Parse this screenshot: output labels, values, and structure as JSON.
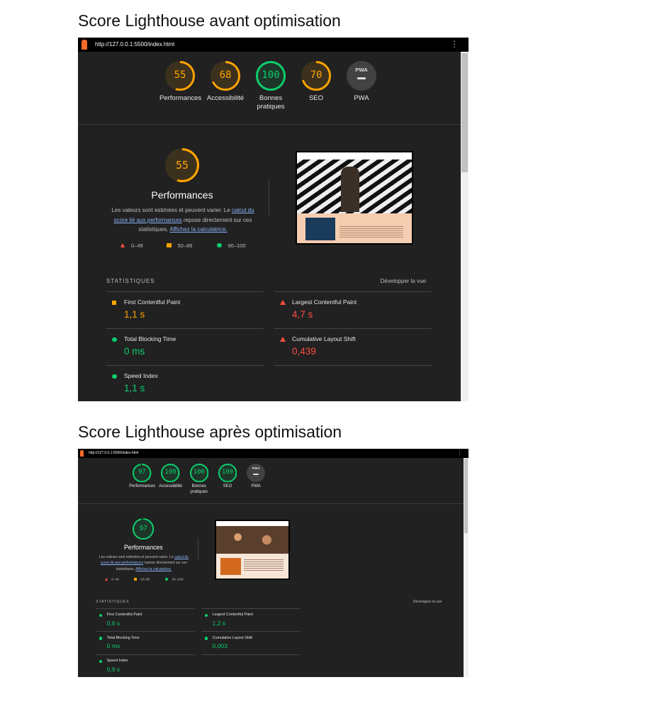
{
  "headings": {
    "before": "Score Lighthouse avant optimisation",
    "after": "Score Lighthouse après optimisation"
  },
  "colors": {
    "fail": "#ff4e42",
    "average": "#ffa400",
    "pass": "#0cce6b",
    "report_bg": "#212121"
  },
  "before": {
    "url": "http://127.0.0.1:5500/index.html",
    "scores": [
      {
        "label": "Performances",
        "value": "55",
        "score": 55,
        "status": "average"
      },
      {
        "label": "Accessibilité",
        "value": "68",
        "score": 68,
        "status": "average"
      },
      {
        "label": "Bonnes pratiques",
        "value": "100",
        "score": 100,
        "status": "pass"
      },
      {
        "label": "SEO",
        "value": "70",
        "score": 70,
        "status": "average"
      },
      {
        "label": "PWA",
        "value": "PWA",
        "status": "na"
      }
    ],
    "perf": {
      "score": 55,
      "value": "55",
      "title": "Performances",
      "desc_1": "Les valeurs sont estimées et peuvent varier. Le ",
      "desc_link_1": "calcul du score lié aux performances",
      "desc_2": " repose directement sur ces statistiques. ",
      "desc_link_2": "Affichez la calculatrice."
    },
    "legend": [
      "0–49",
      "50–89",
      "90–100"
    ],
    "stats_label": "STATISTIQUES",
    "expand_label": "Développer la vue",
    "metrics": [
      {
        "name": "First Contentful Paint",
        "value": "1,1 s",
        "status": "average"
      },
      {
        "name": "Largest Contentful Paint",
        "value": "4,7 s",
        "status": "fail"
      },
      {
        "name": "Total Blocking Time",
        "value": "0 ms",
        "status": "pass"
      },
      {
        "name": "Cumulative Layout Shift",
        "value": "0,439",
        "status": "fail"
      },
      {
        "name": "Speed Index",
        "value": "1,1 s",
        "status": "pass"
      }
    ]
  },
  "after": {
    "url": "http://127.0.0.1:5500/index.html",
    "scores": [
      {
        "label": "Performances",
        "value": "97",
        "score": 97,
        "status": "pass"
      },
      {
        "label": "Accessibilité",
        "value": "100",
        "score": 100,
        "status": "pass"
      },
      {
        "label": "Bonnes pratiques",
        "value": "100",
        "score": 100,
        "status": "pass"
      },
      {
        "label": "SEO",
        "value": "100",
        "score": 100,
        "status": "pass"
      },
      {
        "label": "PWA",
        "value": "PWA",
        "status": "na"
      }
    ],
    "perf": {
      "score": 97,
      "value": "97",
      "title": "Performances",
      "desc_1": "Les valeurs sont estimées et peuvent varier. Le ",
      "desc_link_1": "calcul du score lié aux performances",
      "desc_2": " repose directement sur ces statistiques. ",
      "desc_link_2": "Affichez la calculatrice."
    },
    "legend": [
      "0–49",
      "50–89",
      "90–100"
    ],
    "stats_label": "STATISTIQUES",
    "expand_label": "Développer la vue",
    "metrics": [
      {
        "name": "First Contentful Paint",
        "value": "0,6 s",
        "status": "pass"
      },
      {
        "name": "Largest Contentful Paint",
        "value": "1,2 s",
        "status": "pass"
      },
      {
        "name": "Total Blocking Time",
        "value": "0 ms",
        "status": "pass"
      },
      {
        "name": "Cumulative Layout Shift",
        "value": "0,003",
        "status": "pass"
      },
      {
        "name": "Speed Index",
        "value": "0,9 s",
        "status": "pass"
      }
    ]
  }
}
